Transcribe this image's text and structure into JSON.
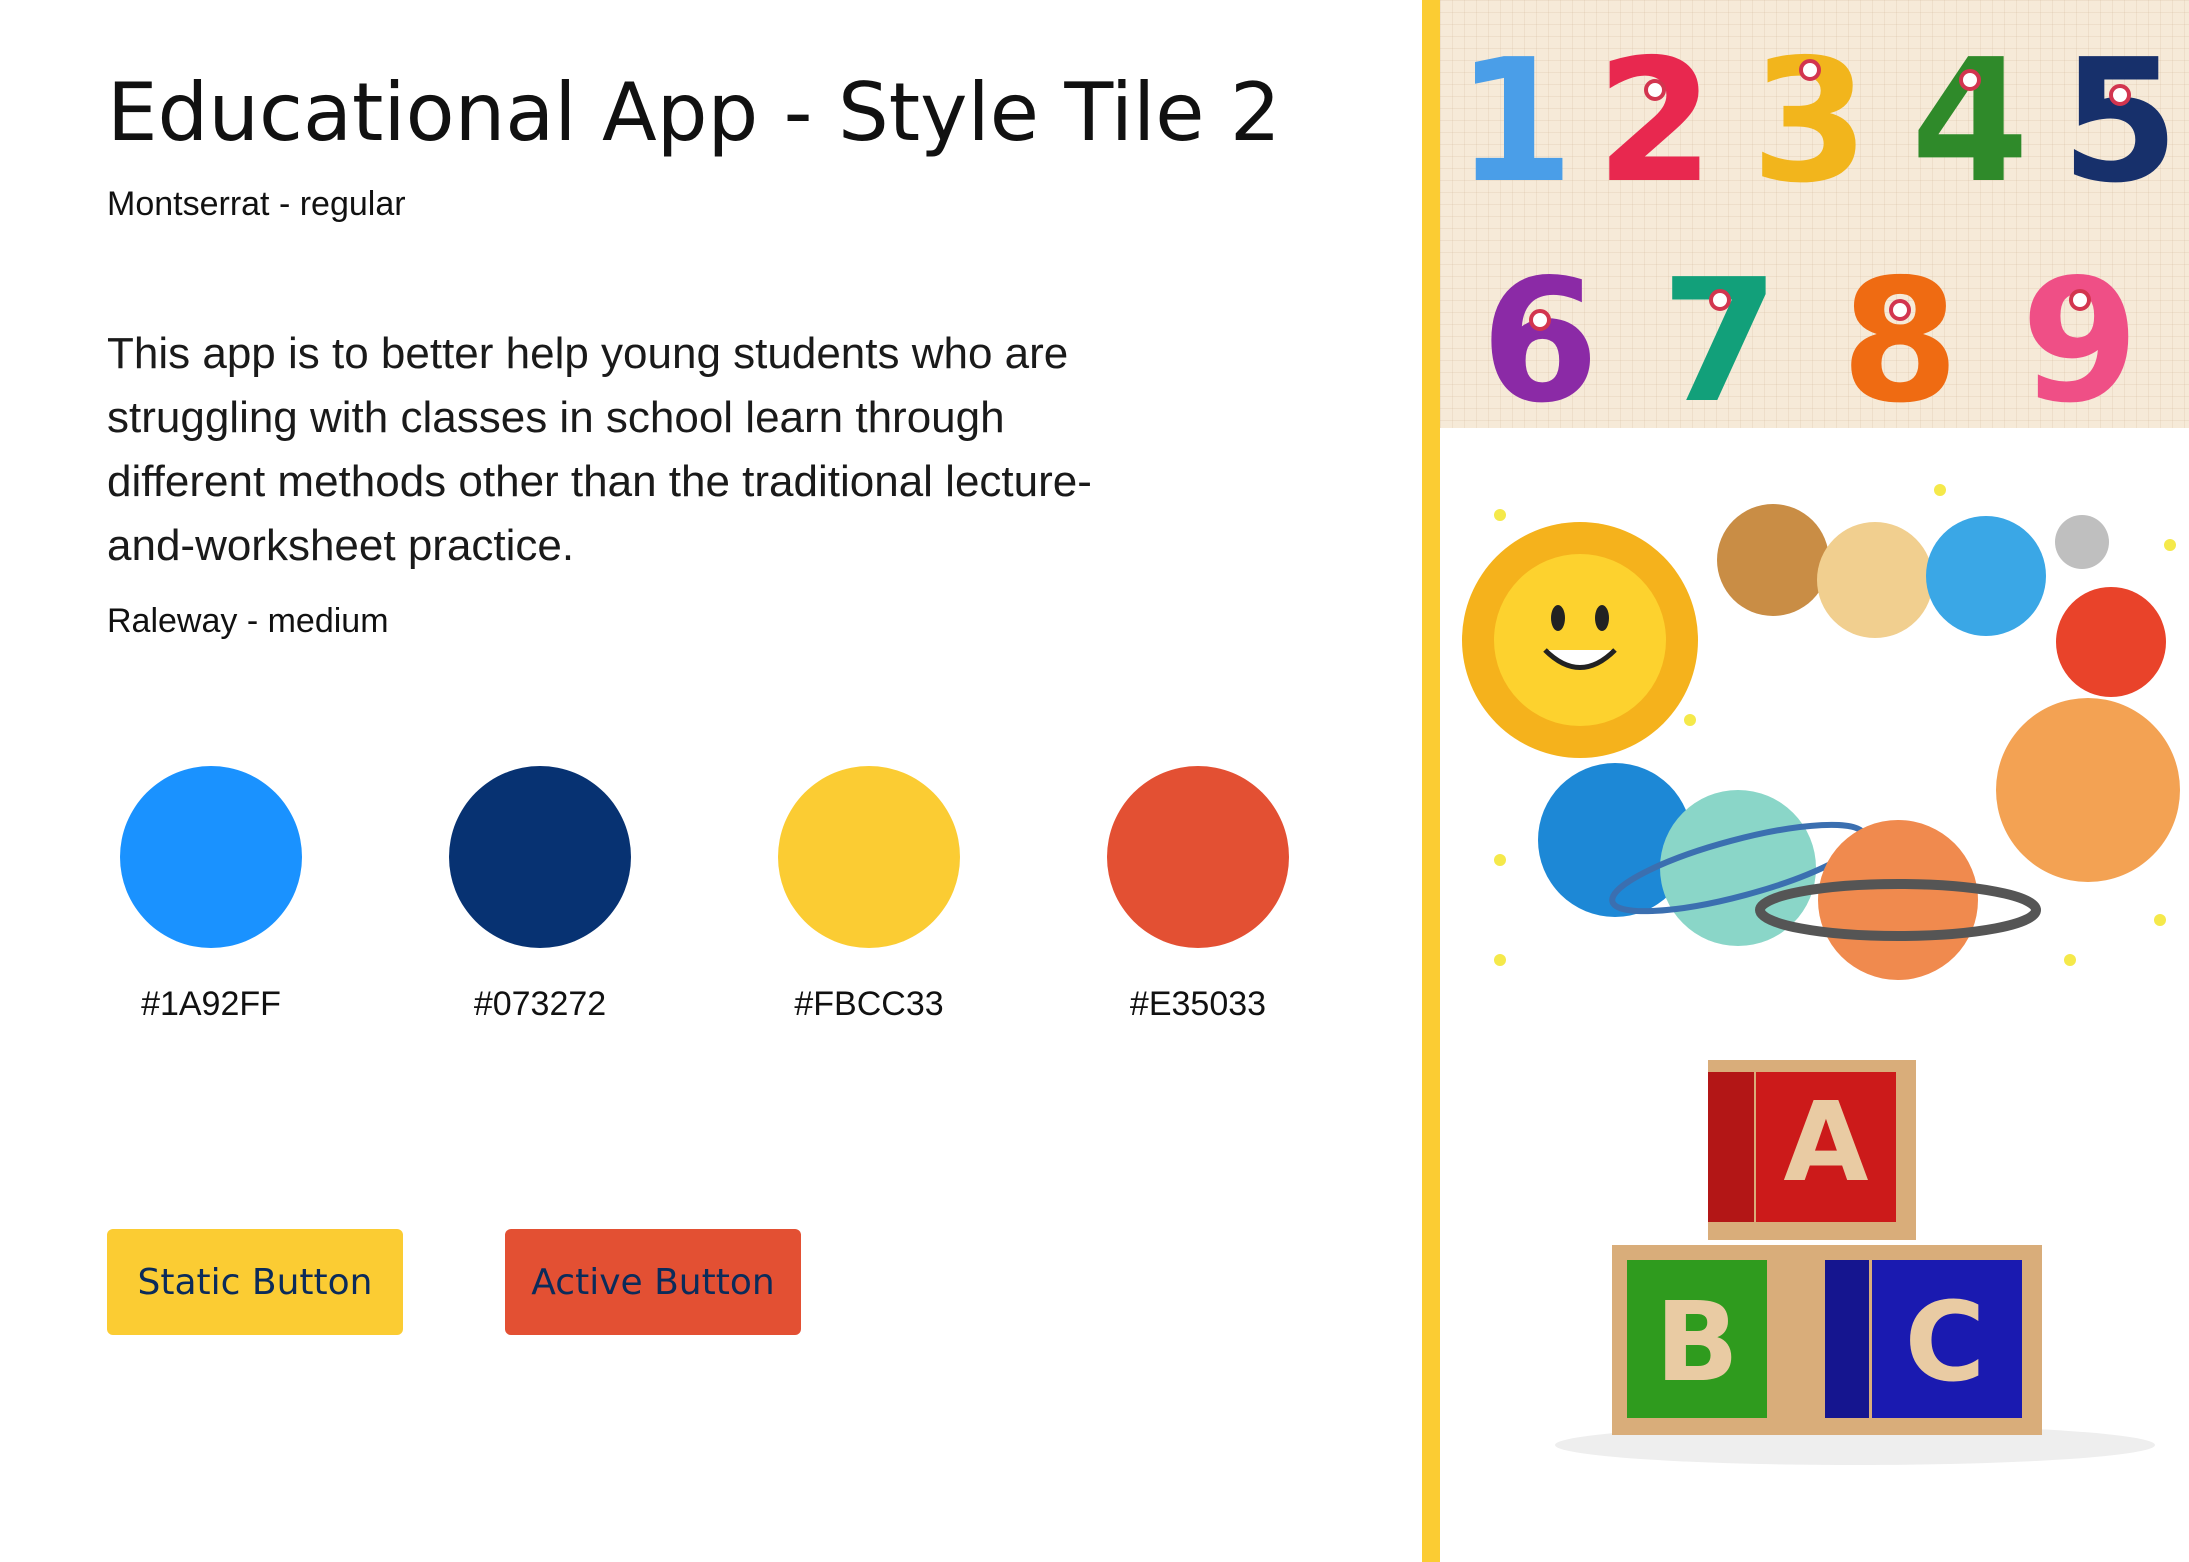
{
  "header": {
    "title": "Educational App - Style Tile 2",
    "title_font_note": "Montserrat - regular"
  },
  "body": {
    "description": "This app is to better help young students who are struggling with classes in school learn through different methods other than the traditional lecture-and-worksheet practice.",
    "body_font_note": "Raleway - medium"
  },
  "palette": [
    {
      "hex": "#1A92FF",
      "label": "#1A92FF"
    },
    {
      "hex": "#073272",
      "label": "#073272"
    },
    {
      "hex": "#FBCC33",
      "label": "#FBCC33"
    },
    {
      "hex": "#E35033",
      "label": "#E35033"
    }
  ],
  "buttons": {
    "static": {
      "label": "Static Button",
      "color": "#FBCC33"
    },
    "active": {
      "label": "Active Button",
      "color": "#E35033"
    }
  },
  "illustrations": {
    "numbers": [
      "1",
      "2",
      "3",
      "4",
      "5",
      "6",
      "7",
      "8",
      "9"
    ],
    "blocks": [
      "A",
      "B",
      "C",
      "C"
    ],
    "divider_color": "#FBCC33"
  }
}
